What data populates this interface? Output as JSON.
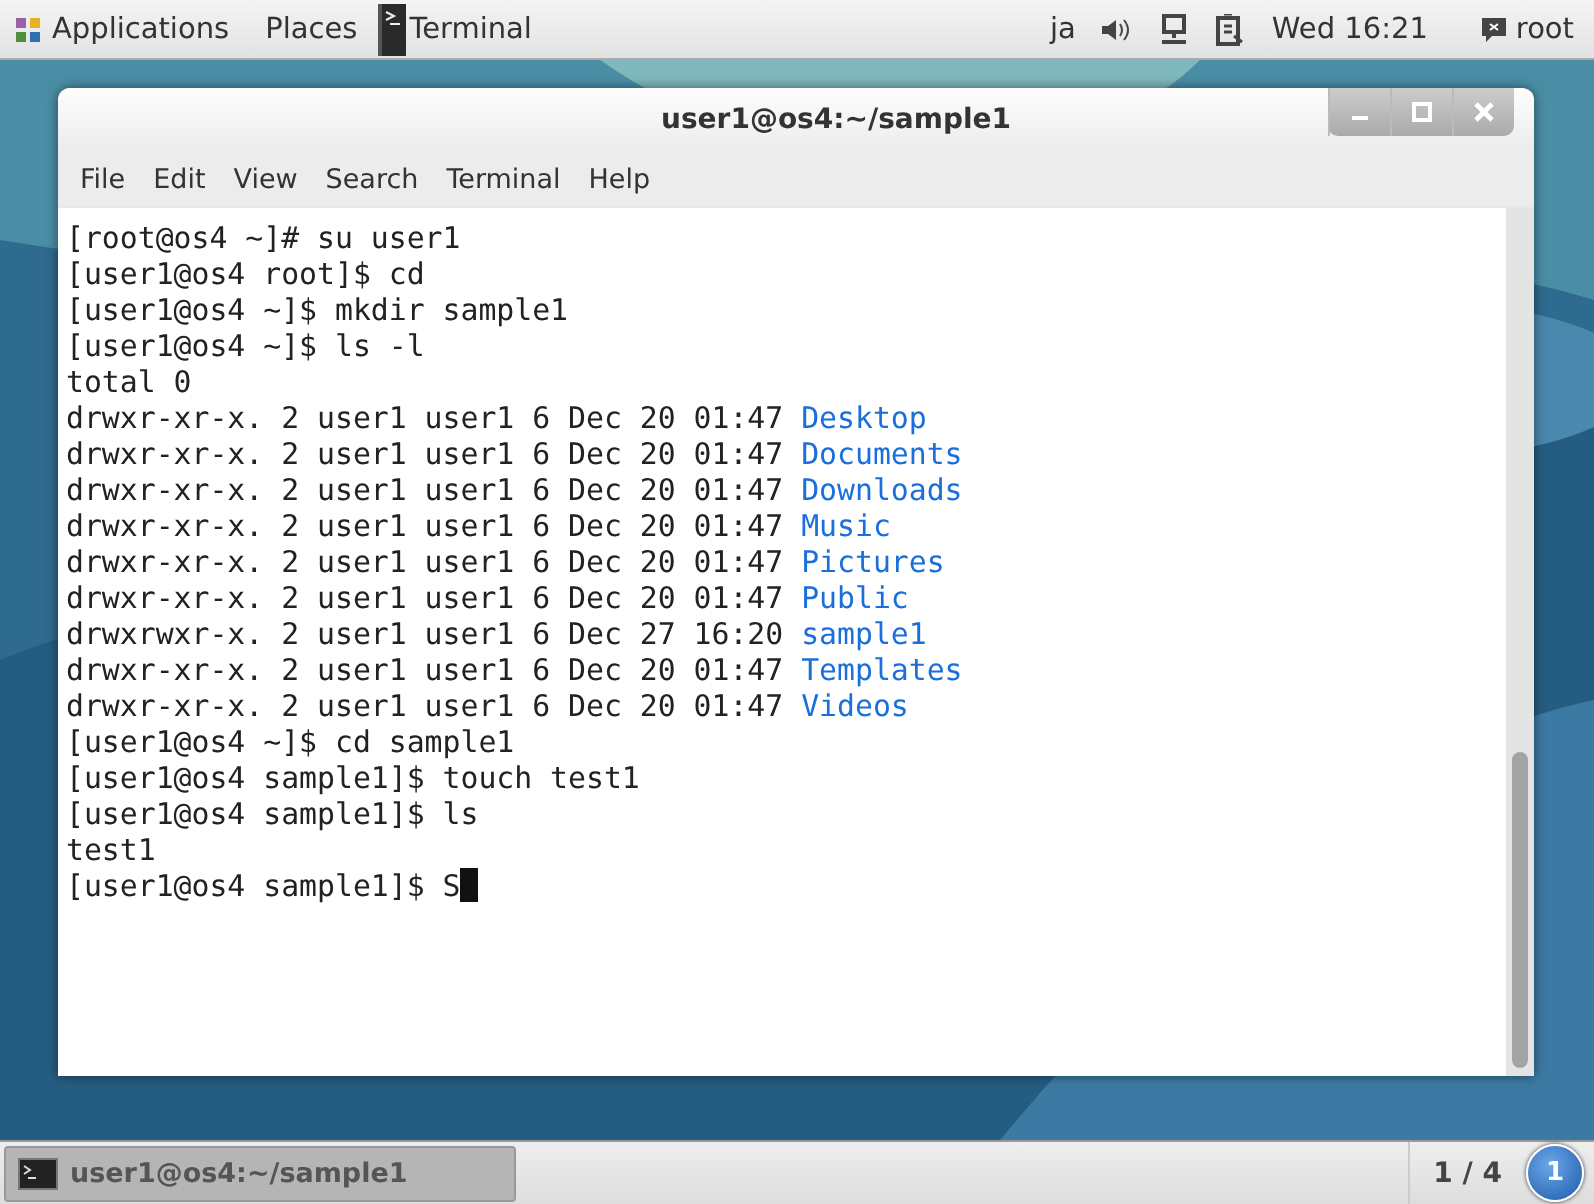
{
  "top_bar": {
    "applications": "Applications",
    "places": "Places",
    "app": "Terminal",
    "input_method": "ja",
    "clock": "Wed 16:21",
    "user": "root"
  },
  "window": {
    "title": "user1@os4:~/sample1",
    "menu": [
      "File",
      "Edit",
      "View",
      "Search",
      "Terminal",
      "Help"
    ],
    "lines": [
      {
        "text": "[root@os4 ~]# su user1"
      },
      {
        "text": "[user1@os4 root]$ cd"
      },
      {
        "text": "[user1@os4 ~]$ mkdir sample1"
      },
      {
        "text": "[user1@os4 ~]$ ls -l"
      },
      {
        "text": "total 0"
      },
      {
        "text": "drwxr-xr-x. 2 user1 user1 6 Dec 20 01:47",
        "entry": "Desktop"
      },
      {
        "text": "drwxr-xr-x. 2 user1 user1 6 Dec 20 01:47",
        "entry": "Documents"
      },
      {
        "text": "drwxr-xr-x. 2 user1 user1 6 Dec 20 01:47",
        "entry": "Downloads"
      },
      {
        "text": "drwxr-xr-x. 2 user1 user1 6 Dec 20 01:47",
        "entry": "Music"
      },
      {
        "text": "drwxr-xr-x. 2 user1 user1 6 Dec 20 01:47",
        "entry": "Pictures"
      },
      {
        "text": "drwxr-xr-x. 2 user1 user1 6 Dec 20 01:47",
        "entry": "Public"
      },
      {
        "text": "drwxrwxr-x. 2 user1 user1 6 Dec 27 16:20",
        "entry": "sample1"
      },
      {
        "text": "drwxr-xr-x. 2 user1 user1 6 Dec 20 01:47",
        "entry": "Templates"
      },
      {
        "text": "drwxr-xr-x. 2 user1 user1 6 Dec 20 01:47",
        "entry": "Videos"
      },
      {
        "text": "[user1@os4 ~]$ cd sample1"
      },
      {
        "text": "[user1@os4 sample1]$ touch test1"
      },
      {
        "text": "[user1@os4 sample1]$ ls"
      },
      {
        "text": "test1"
      },
      {
        "text": "[user1@os4 sample1]$ S",
        "cursor": true
      }
    ]
  },
  "taskbar": {
    "task": "user1@os4:~/sample1",
    "workspace": "1 / 4",
    "notifications": "1"
  }
}
